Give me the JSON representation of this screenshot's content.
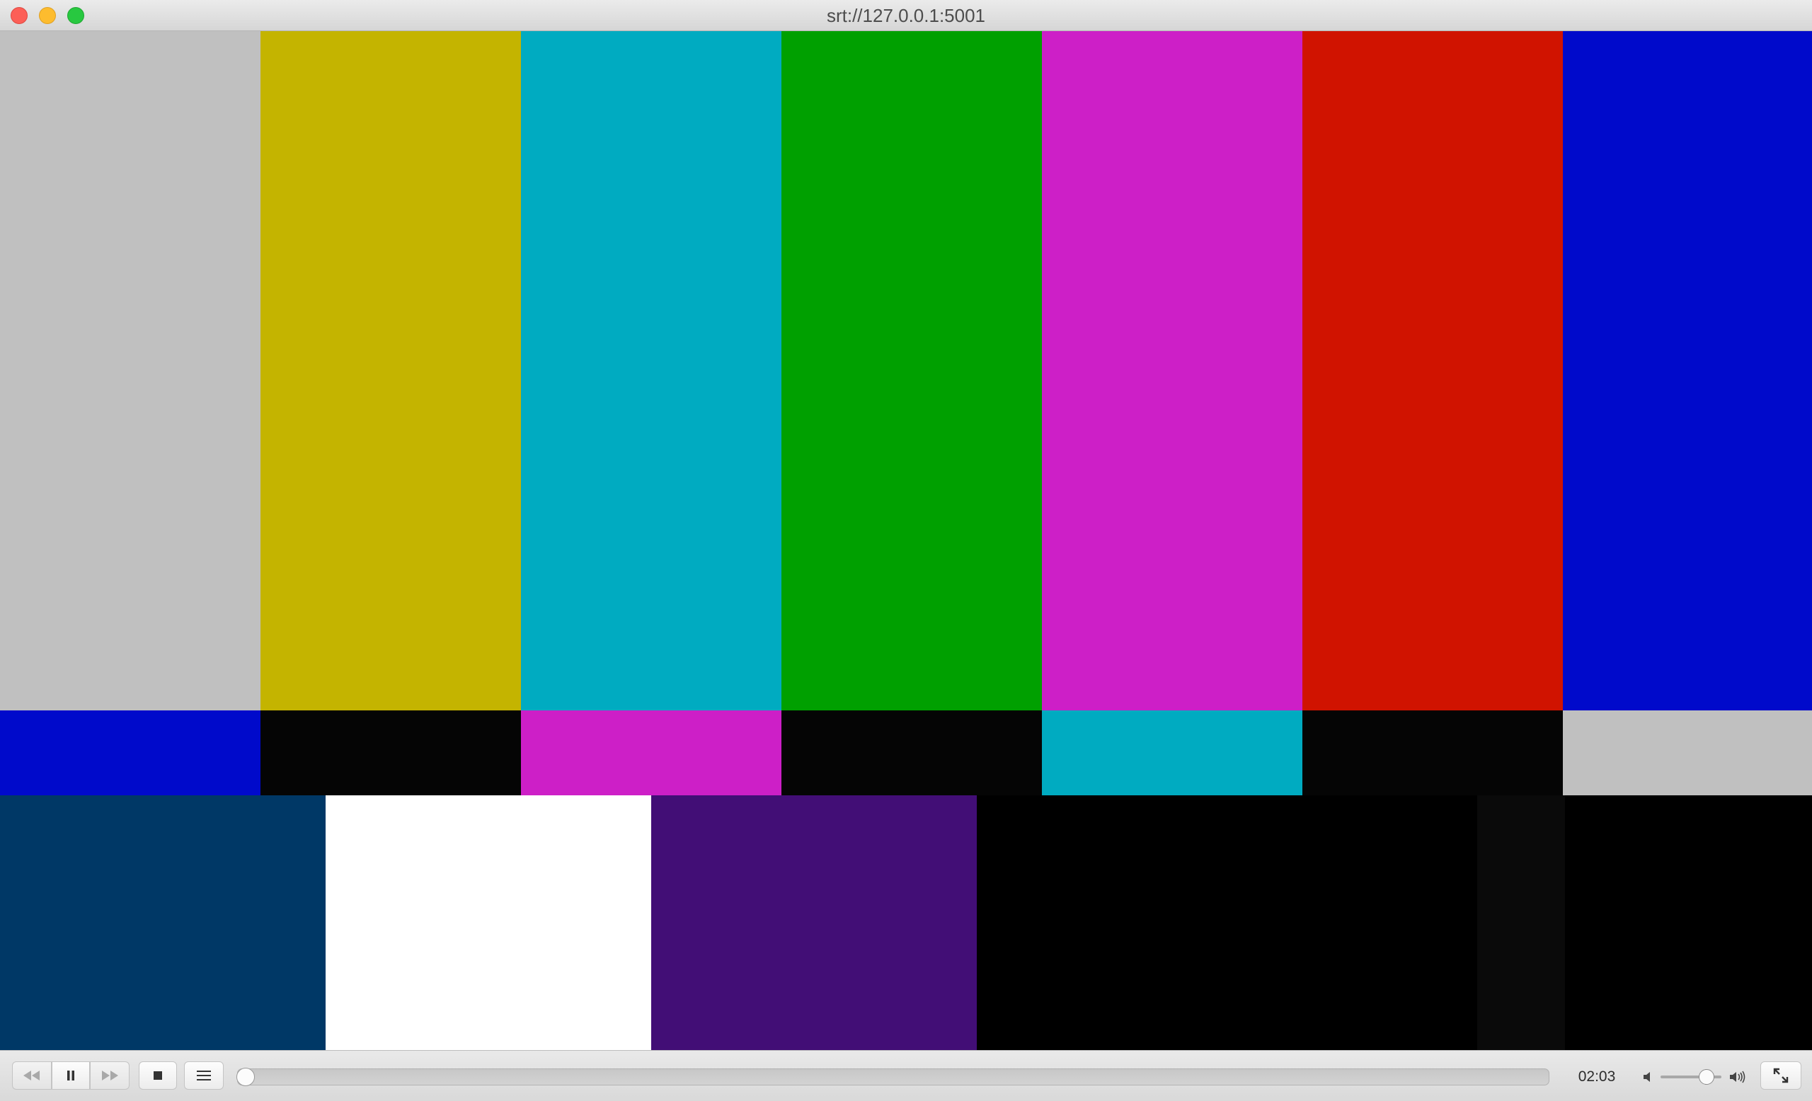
{
  "window": {
    "title": "srt://127.0.0.1:5001"
  },
  "video": {
    "top_bars": [
      "#c0c0c0",
      "#c4b400",
      "#00abc1",
      "#00a000",
      "#cd1fc7",
      "#d01300",
      "#000acb"
    ],
    "middle_bars": [
      "#000acb",
      "#050505",
      "#cd1fc7",
      "#050505",
      "#00abc1",
      "#050505",
      "#c0c0c0"
    ],
    "bottom_blocks": [
      "#003866",
      "#ffffff",
      "#420e76",
      "#000000",
      "#000000",
      "#0a0a0a",
      "#000000"
    ]
  },
  "controller": {
    "rewind_icon": "rewind-icon",
    "pause_icon": "pause-icon",
    "forward_icon": "fast-forward-icon",
    "stop_icon": "stop-icon",
    "playlist_icon": "playlist-icon",
    "elapsed_time": "02:03",
    "seek_progress": 0.0,
    "volume_level": 0.75,
    "fullscreen_icon": "fullscreen-icon",
    "volume_min_icon": "speaker-min-icon",
    "volume_max_icon": "speaker-max-icon"
  }
}
